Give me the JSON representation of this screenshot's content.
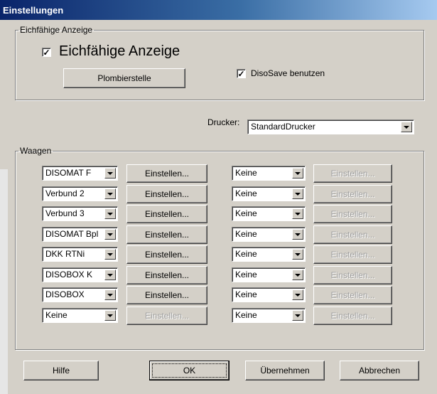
{
  "window": {
    "title": "Einstellungen"
  },
  "eichfaehig": {
    "group_label": "Eichfähige Anzeige",
    "checkbox_label": "Eichfähige Anzeige",
    "checked": true,
    "plombier_button": "Plombierstelle",
    "disosave_label": "DisoSave benutzen",
    "disosave_checked": true
  },
  "drucker": {
    "label": "Drucker:",
    "value": "StandardDrucker"
  },
  "waagen": {
    "group_label": "Waagen",
    "rows": [
      {
        "scale": "DISOMAT F",
        "config": "Einstellen...",
        "config_enabled": true,
        "second": "Keine",
        "second_config": "Einstellen..."
      },
      {
        "scale": "Verbund 2",
        "config": "Einstellen...",
        "config_enabled": true,
        "second": "Keine",
        "second_config": "Einstellen..."
      },
      {
        "scale": "Verbund 3",
        "config": "Einstellen...",
        "config_enabled": true,
        "second": "Keine",
        "second_config": "Einstellen..."
      },
      {
        "scale": "DISOMAT Bpl",
        "config": "Einstellen...",
        "config_enabled": true,
        "second": "Keine",
        "second_config": "Einstellen..."
      },
      {
        "scale": "DKK RTNi",
        "config": "Einstellen...",
        "config_enabled": true,
        "second": "Keine",
        "second_config": "Einstellen..."
      },
      {
        "scale": "DISOBOX K",
        "config": "Einstellen...",
        "config_enabled": true,
        "second": "Keine",
        "second_config": "Einstellen..."
      },
      {
        "scale": "DISOBOX",
        "config": "Einstellen...",
        "config_enabled": true,
        "second": "Keine",
        "second_config": "Einstellen..."
      },
      {
        "scale": "Keine",
        "config": "Einstellen...",
        "config_enabled": false,
        "second": "Keine",
        "second_config": "Einstellen..."
      }
    ]
  },
  "buttons": {
    "help": "Hilfe",
    "ok": "OK",
    "apply": "Übernehmen",
    "cancel": "Abbrechen"
  }
}
